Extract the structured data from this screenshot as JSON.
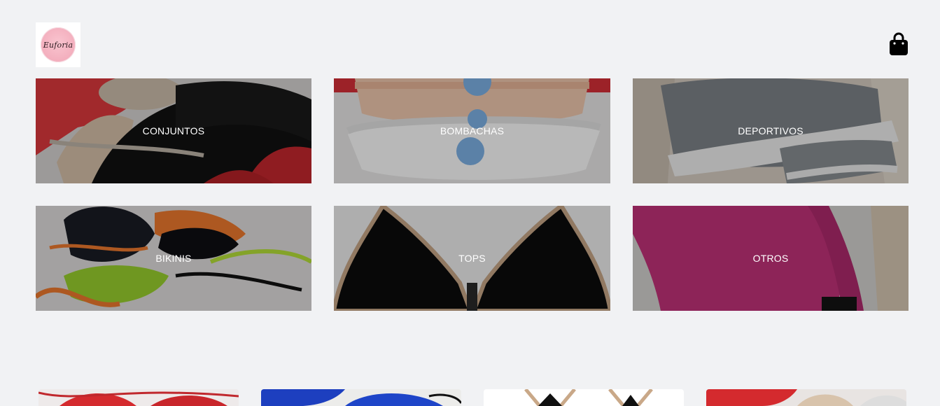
{
  "header": {
    "logo_text": "Euforia",
    "cart_icon": "shopping-bag-icon"
  },
  "categories": [
    {
      "label": "CONJUNTOS"
    },
    {
      "label": "BOMBACHAS"
    },
    {
      "label": "DEPORTIVOS"
    },
    {
      "label": "BIKINIS"
    },
    {
      "label": "TOPS"
    },
    {
      "label": "OTROS"
    }
  ],
  "colors": {
    "background": "#f1f2f4",
    "overlay": "rgba(0,0,0,0.28)",
    "label": "#ffffff"
  }
}
